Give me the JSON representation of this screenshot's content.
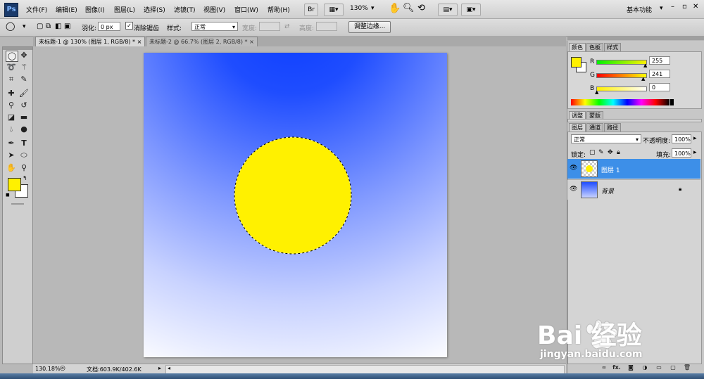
{
  "menubar": {
    "logo": "Ps",
    "items": [
      "文件(F)",
      "编辑(E)",
      "图像(I)",
      "图层(L)",
      "选择(S)",
      "滤镜(T)",
      "视图(V)",
      "窗口(W)",
      "帮助(H)"
    ],
    "bridge_label": "Br",
    "zoom": "130%",
    "workspace": "基本功能"
  },
  "options": {
    "feather_label": "羽化:",
    "feather_value": "0 px",
    "antialias_label": "消除锯齿",
    "style_label": "样式:",
    "style_value": "正常",
    "width_label": "宽度:",
    "height_label": "高度:",
    "refine_button": "调整边缘..."
  },
  "tabs": [
    {
      "label": "未标题-1 @ 130% (图层 1, RGB/8) *",
      "close": "×"
    },
    {
      "label": "未标题-2 @ 66.7% (图层 2, RGB/8) *",
      "close": "×"
    }
  ],
  "status": {
    "zoom": "130.18%",
    "doc_info": "文档:603.9K/402.6K"
  },
  "color_panel": {
    "tabs": [
      "颜色",
      "色板",
      "样式"
    ],
    "r_label": "R",
    "g_label": "G",
    "b_label": "B",
    "r": "255",
    "g": "241",
    "b": "0",
    "fg_color": "#fff100"
  },
  "adjust_panel": {
    "tabs": [
      "调整",
      "蒙版"
    ]
  },
  "layers_panel": {
    "tabs": [
      "图层",
      "通道",
      "路径"
    ],
    "blend_mode": "正常",
    "opacity_label": "不透明度:",
    "opacity": "100%",
    "lock_label": "锁定:",
    "fill_label": "填充:",
    "fill": "100%",
    "layers": [
      {
        "name": "图层 1",
        "selected": true
      },
      {
        "name": "背景",
        "selected": false
      }
    ],
    "footer_buttons": [
      "链接",
      "fx.",
      "蒙版",
      "调整",
      "组",
      "新建",
      "删除"
    ]
  },
  "watermark": {
    "brand": "Bai 经验",
    "url": "jingyan.baidu.com"
  }
}
